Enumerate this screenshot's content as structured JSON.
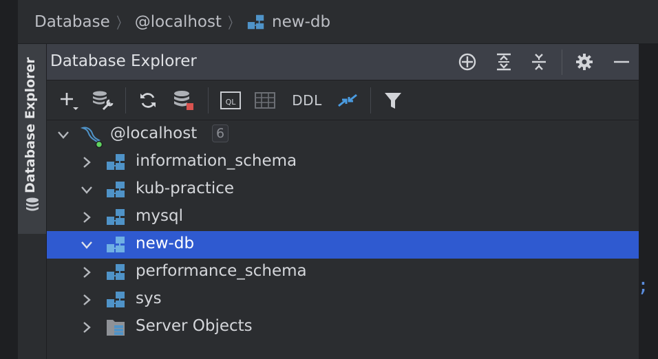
{
  "breadcrumb": {
    "items": [
      "Database",
      "@localhost",
      "new-db"
    ],
    "separator": "〉"
  },
  "sidebar": {
    "tab_label": "Database Explorer",
    "tab_icon": "database-icon"
  },
  "panel": {
    "title": "Database Explorer",
    "header_actions": [
      "locate-icon",
      "expand-all-icon",
      "collapse-all-icon",
      "settings-icon",
      "minimize-icon"
    ]
  },
  "toolbar": {
    "buttons": [
      "add-icon",
      "data-source-properties-icon",
      "refresh-icon",
      "disconnect-icon",
      "query-console-icon",
      "table-editor-icon",
      "DDL",
      "jump-to-source-icon",
      "filter-icon"
    ],
    "ddl_label": "DDL"
  },
  "tree": {
    "root": {
      "label": "@localhost",
      "count": "6",
      "expanded": true,
      "icon": "mysql-dolphin-icon"
    },
    "children": [
      {
        "label": "information_schema",
        "expanded": false,
        "icon": "schema-icon",
        "selected": false
      },
      {
        "label": "kub-practice",
        "expanded": true,
        "icon": "schema-icon",
        "selected": false
      },
      {
        "label": "mysql",
        "expanded": false,
        "icon": "schema-icon",
        "selected": false
      },
      {
        "label": "new-db",
        "expanded": true,
        "icon": "schema-icon",
        "selected": true
      },
      {
        "label": "performance_schema",
        "expanded": false,
        "icon": "schema-icon",
        "selected": false
      },
      {
        "label": "sys",
        "expanded": false,
        "icon": "schema-icon",
        "selected": false
      },
      {
        "label": "Server Objects",
        "expanded": false,
        "icon": "server-objects-folder-icon",
        "selected": false
      }
    ]
  },
  "editor": {
    "visible_glyph": ";"
  },
  "colors": {
    "selection": "#2f5ad0",
    "accent_blue": "#5b9bd5",
    "header_bg": "#3d4048",
    "panel_bg": "#2b2d30",
    "status_connected": "#5fd35f",
    "disconnect_red": "#d9534f"
  }
}
